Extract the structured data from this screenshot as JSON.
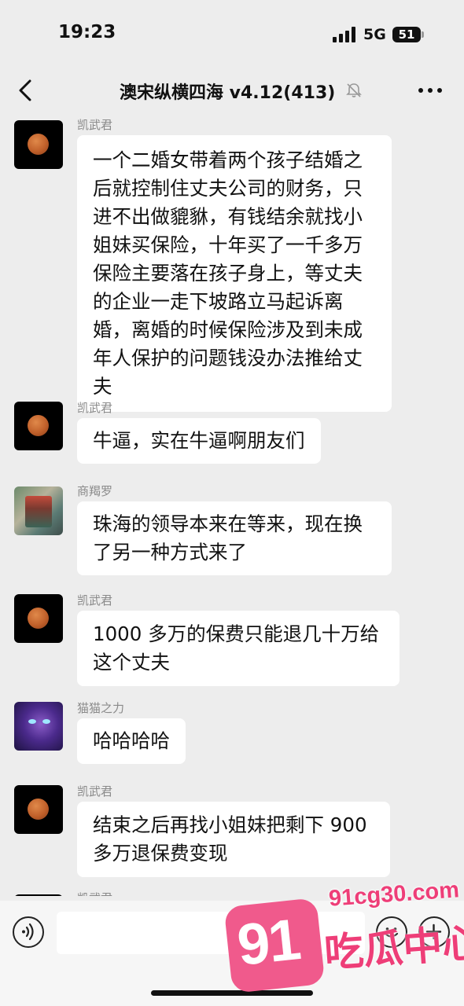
{
  "status_bar": {
    "time": "19:23",
    "network": "5G",
    "battery": "51"
  },
  "nav": {
    "title": "澳宋纵横四海 v4.12(413)"
  },
  "messages": [
    {
      "sender": "凯武君",
      "avatar": "moon-avatar",
      "lines": [
        "一个二婚女带着两个孩子结婚之",
        "后就控制住丈夫公司的财务，只",
        "进不出做貔貅，有钱结余就找小",
        "姐妹买保险，十年买了一千多万",
        "保险主要落在孩子身上，等丈夫",
        "的企业一走下坡路立马起诉离",
        "婚，离婚的时候保险涉及到未成",
        "年人保护的问题钱没办法推给丈",
        "夫"
      ]
    },
    {
      "sender": "凯武君",
      "avatar": "moon-avatar",
      "lines": [
        "牛逼，实在牛逼啊朋友们"
      ]
    },
    {
      "sender": "商羯罗",
      "avatar": "city-avatar",
      "lines": [
        "珠海的领导本来在等来，现在换",
        "了另一种方式来了"
      ]
    },
    {
      "sender": "凯武君",
      "avatar": "moon-avatar",
      "lines": [
        "1000 多万的保费只能退几十万给",
        "这个丈夫"
      ]
    },
    {
      "sender": "猫猫之力",
      "avatar": "cat-avatar",
      "lines": [
        "哈哈哈哈"
      ]
    },
    {
      "sender": "凯武君",
      "avatar": "moon-avatar",
      "lines": [
        "结束之后再找小姐妹把剩下 900",
        "多万退保费变现"
      ]
    },
    {
      "sender": "凯武君",
      "avatar": "moon-avatar",
      "lines": []
    }
  ],
  "input": {
    "placeholder": ""
  },
  "watermark": {
    "url": "91cg30.com",
    "number": "91",
    "text": "吃瓜中心"
  }
}
